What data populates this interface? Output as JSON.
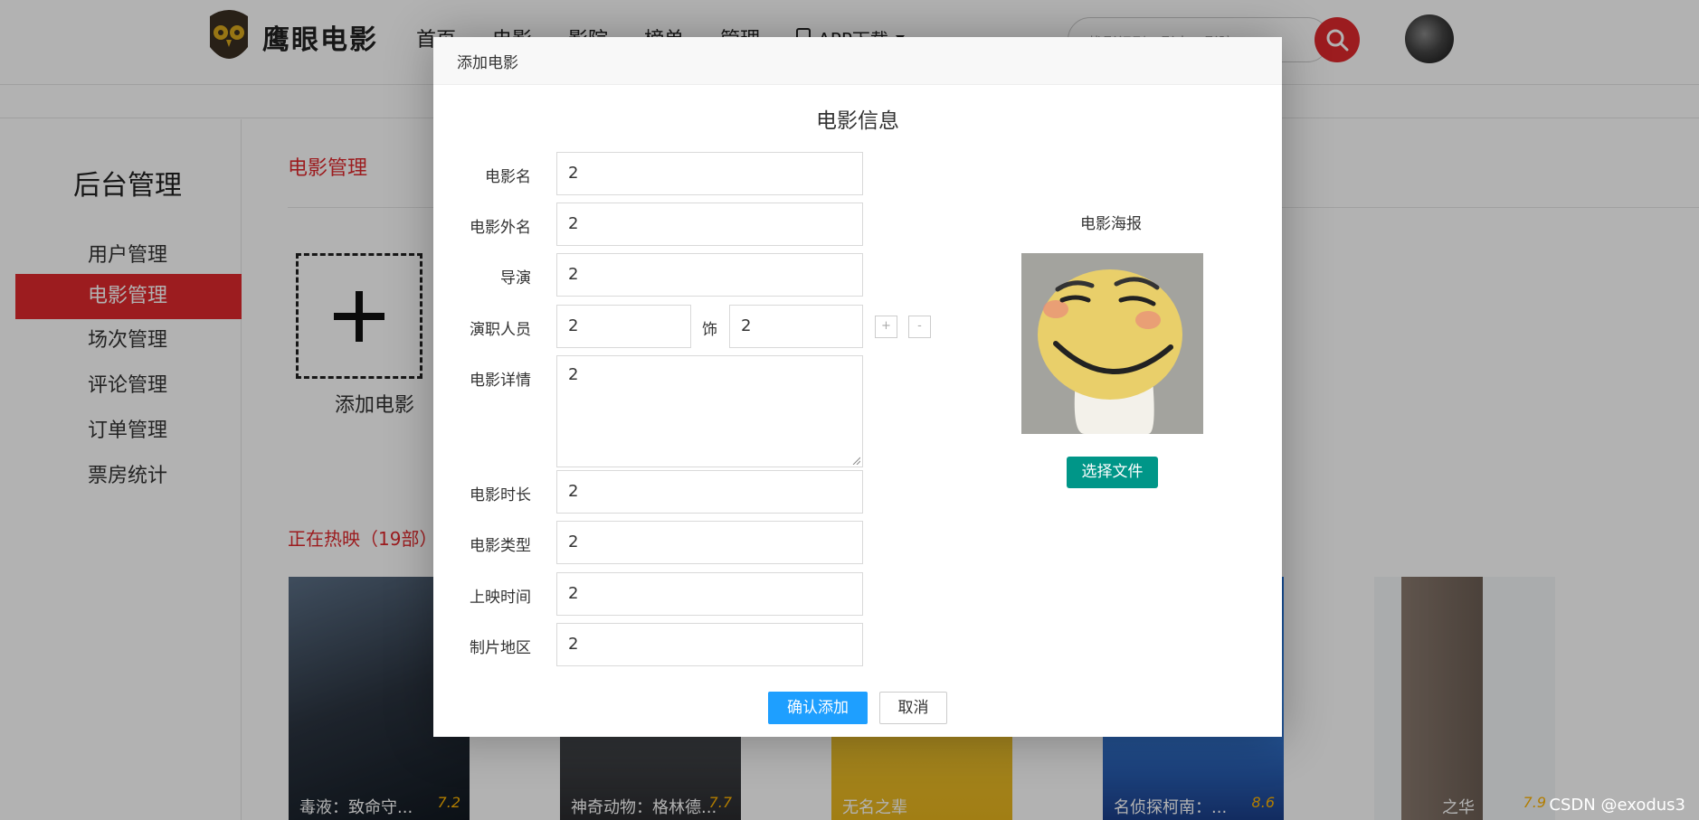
{
  "header": {
    "logo_text": "鹰眼电影",
    "nav": [
      "首页",
      "电影",
      "影院",
      "榜单",
      "管理"
    ],
    "app_download": "APP下载",
    "search_placeholder": "找影视剧、影人、影院"
  },
  "sidebar": {
    "title": "后台管理",
    "items": [
      {
        "label": "用户管理",
        "active": false
      },
      {
        "label": "电影管理",
        "active": true
      },
      {
        "label": "场次管理",
        "active": false
      },
      {
        "label": "评论管理",
        "active": false
      },
      {
        "label": "订单管理",
        "active": false
      },
      {
        "label": "票房统计",
        "active": false
      }
    ]
  },
  "main": {
    "section_title": "电影管理",
    "add_movie_label": "添加电影",
    "hot_title": "正在热映（19部）",
    "posters": [
      {
        "caption": "毒液：致命守...",
        "score": "7.2"
      },
      {
        "caption": "神奇动物：格林德...",
        "score": "7.7"
      },
      {
        "caption": "无名之辈",
        "score": ""
      },
      {
        "caption": "名侦探柯南：...",
        "score": "8.6"
      },
      {
        "caption": "之华",
        "score": "7.9"
      }
    ]
  },
  "dialog": {
    "header": "添加电影",
    "form_title": "电影信息",
    "fields": {
      "name": {
        "label": "电影名",
        "value": "2"
      },
      "foreign_name": {
        "label": "电影外名",
        "value": "2"
      },
      "director": {
        "label": "导演",
        "value": "2"
      },
      "cast": {
        "label": "演职人员",
        "actor": "2",
        "role_label": "饰",
        "role": "2",
        "add": "+",
        "remove": "-"
      },
      "detail": {
        "label": "电影详情",
        "value": "2"
      },
      "duration": {
        "label": "电影时长",
        "value": "2"
      },
      "type": {
        "label": "电影类型",
        "value": "2"
      },
      "release": {
        "label": "上映时间",
        "value": "2"
      },
      "region": {
        "label": "制片地区",
        "value": "2"
      }
    },
    "poster_title": "电影海报",
    "choose_file": "选择文件",
    "confirm": "确认添加",
    "cancel": "取消"
  },
  "watermark": "CSDN @exodus3",
  "colors": {
    "brand_red": "#e0292d",
    "primary_blue": "#1e9fff",
    "teal": "#009688"
  }
}
